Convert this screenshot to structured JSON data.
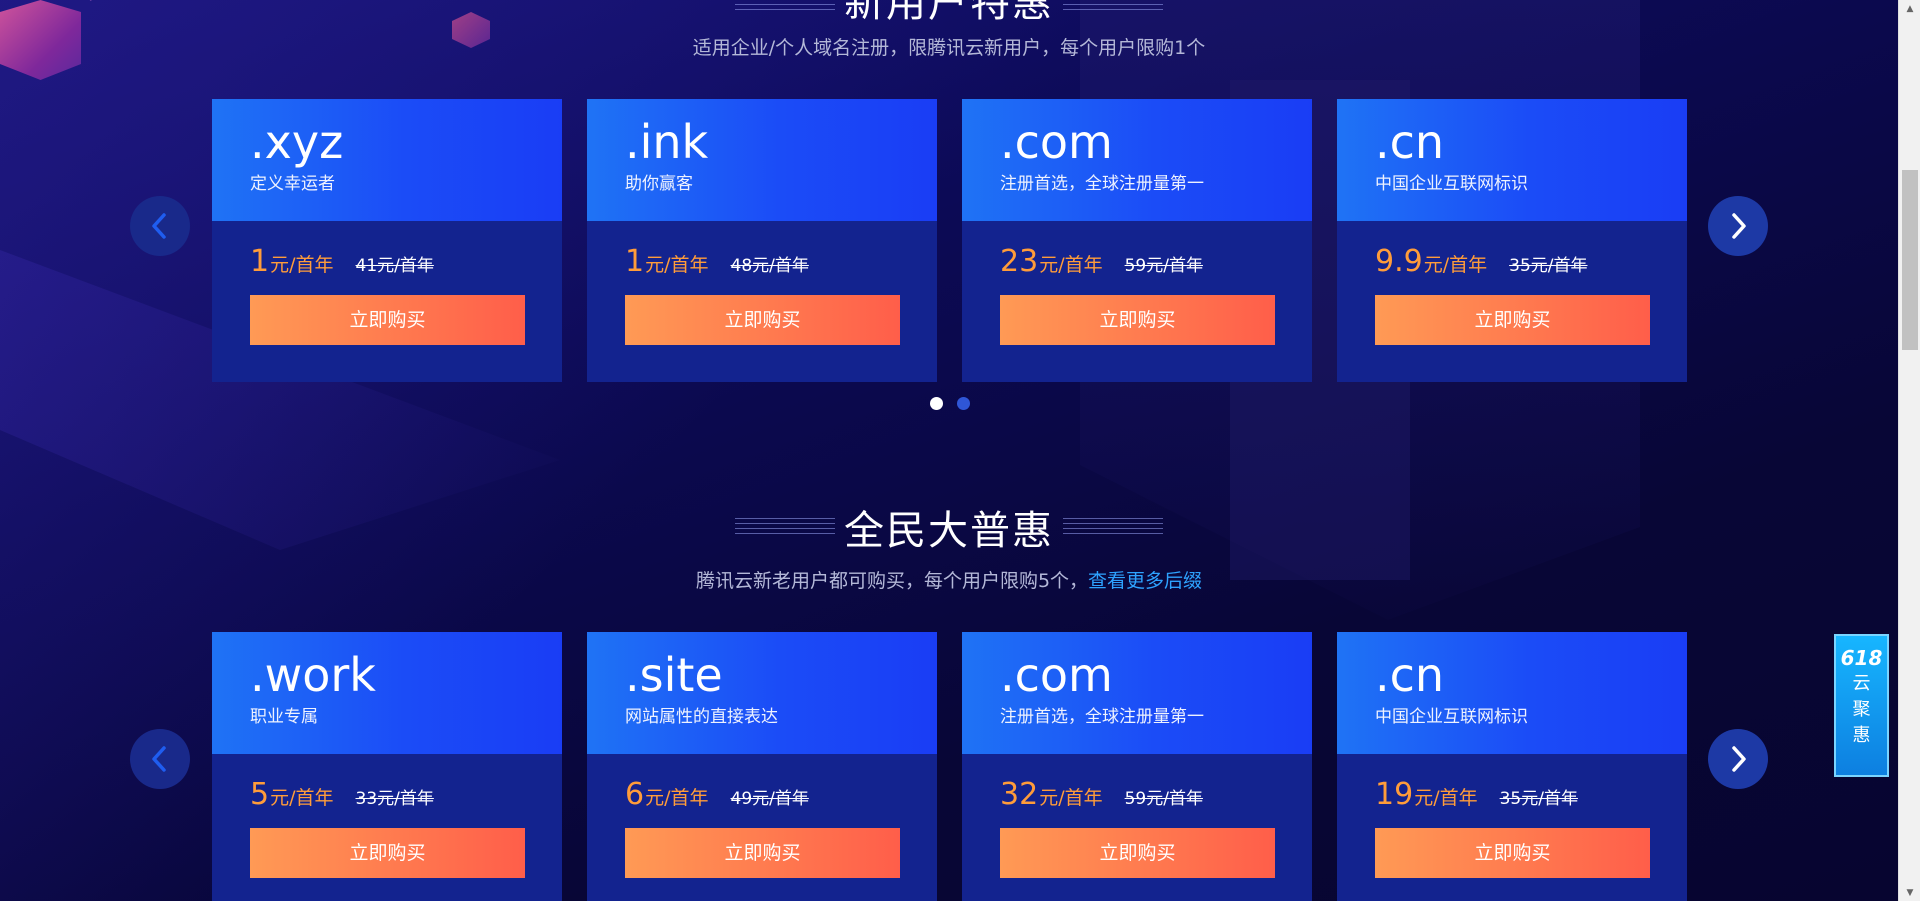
{
  "section1": {
    "title_partial": "新用户特惠",
    "subtitle": "适用企业/个人域名注册，限腾讯云新用户，每个用户限购1个",
    "cards": [
      {
        "domain": ".xyz",
        "desc": "定义幸运者",
        "price": "1",
        "unit": "元/首年",
        "original": "41元/首年",
        "button": "立即购买"
      },
      {
        "domain": ".ink",
        "desc": "助你赢客",
        "price": "1",
        "unit": "元/首年",
        "original": "48元/首年",
        "button": "立即购买"
      },
      {
        "domain": ".com",
        "desc": "注册首选，全球注册量第一",
        "price": "23",
        "unit": "元/首年",
        "original": "59元/首年",
        "button": "立即购买"
      },
      {
        "domain": ".cn",
        "desc": "中国企业互联网标识",
        "price": "9.9",
        "unit": "元/首年",
        "original": "35元/首年",
        "button": "立即购买"
      }
    ]
  },
  "section2": {
    "title": "全民大普惠",
    "subtitle": "腾讯云新老用户都可购买，每个用户限购5个，",
    "subtitle_link": "查看更多后缀",
    "cards": [
      {
        "domain": ".work",
        "desc": "职业专属",
        "price": "5",
        "unit": "元/首年",
        "original": "33元/首年",
        "button": "立即购买"
      },
      {
        "domain": ".site",
        "desc": "网站属性的直接表达",
        "price": "6",
        "unit": "元/首年",
        "original": "49元/首年",
        "button": "立即购买"
      },
      {
        "domain": ".com",
        "desc": "注册首选，全球注册量第一",
        "price": "32",
        "unit": "元/首年",
        "original": "59元/首年",
        "button": "立即购买"
      },
      {
        "domain": ".cn",
        "desc": "中国企业互联网标识",
        "price": "19",
        "unit": "元/首年",
        "original": "35元/首年",
        "button": "立即购买"
      }
    ]
  },
  "float_badge": {
    "number": "618",
    "line1": "云",
    "line2": "聚",
    "line3": "惠"
  },
  "icons": {
    "prev": "chevron-left-icon",
    "next": "chevron-right-icon"
  },
  "colors": {
    "accent_orange": "#ff9c3a",
    "button_start": "#ff9a55",
    "button_end": "#ff5e4a",
    "card_top": "#1b4cf7",
    "card_bottom": "#13238f",
    "link": "#2ea2ff"
  }
}
